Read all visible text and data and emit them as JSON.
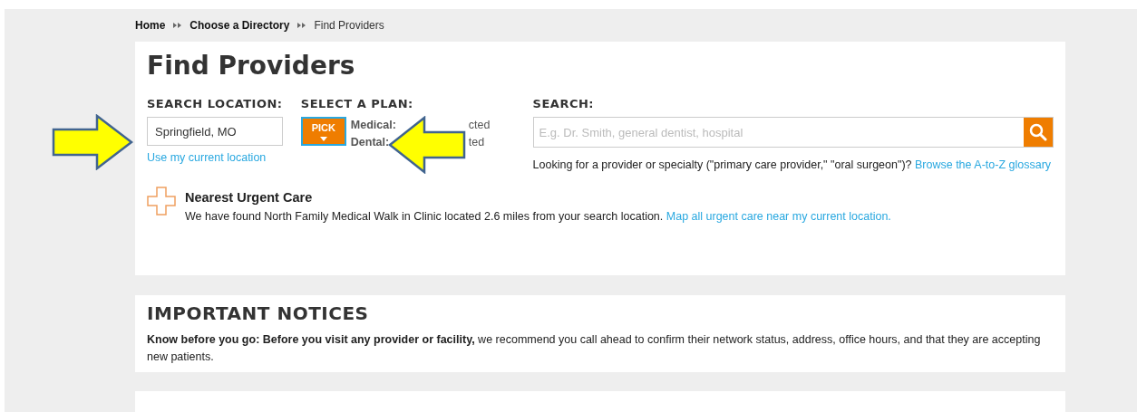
{
  "breadcrumb": [
    {
      "label": "Home",
      "current": false
    },
    {
      "label": "Choose a Directory",
      "current": false
    },
    {
      "label": "Find Providers",
      "current": true
    }
  ],
  "title": "Find Providers",
  "location": {
    "label": "SEARCH LOCATION:",
    "value": "Springfield, MO",
    "link": "Use my current location"
  },
  "plan": {
    "label": "SELECT A PLAN:",
    "button": "PICK",
    "lines": [
      {
        "name": "Medical:",
        "rest": "cted"
      },
      {
        "name": "Dental:",
        "rest": "ted"
      }
    ]
  },
  "search": {
    "label": "SEARCH:",
    "placeholder": "E.g. Dr. Smith, general dentist, hospital",
    "hint": "Looking for a provider or specialty (\"primary care provider,\" \"oral surgeon\")?",
    "hint_link": "Browse the A-to-Z glossary"
  },
  "urgent_care": {
    "title": "Nearest Urgent Care",
    "text": "We have found North Family Medical Walk in Clinic located 2.6 miles from your search location.",
    "link": "Map all urgent care near my current location."
  },
  "notices": {
    "title": "IMPORTANT NOTICES",
    "text": "**Know before you go: Before you visit any provider or facility,** we recommend you call ahead to confirm their network status, address, office hours, and that they are accepting new patients."
  },
  "annotations": [
    {
      "kind": "arrow-right"
    },
    {
      "kind": "arrow-left"
    }
  ]
}
